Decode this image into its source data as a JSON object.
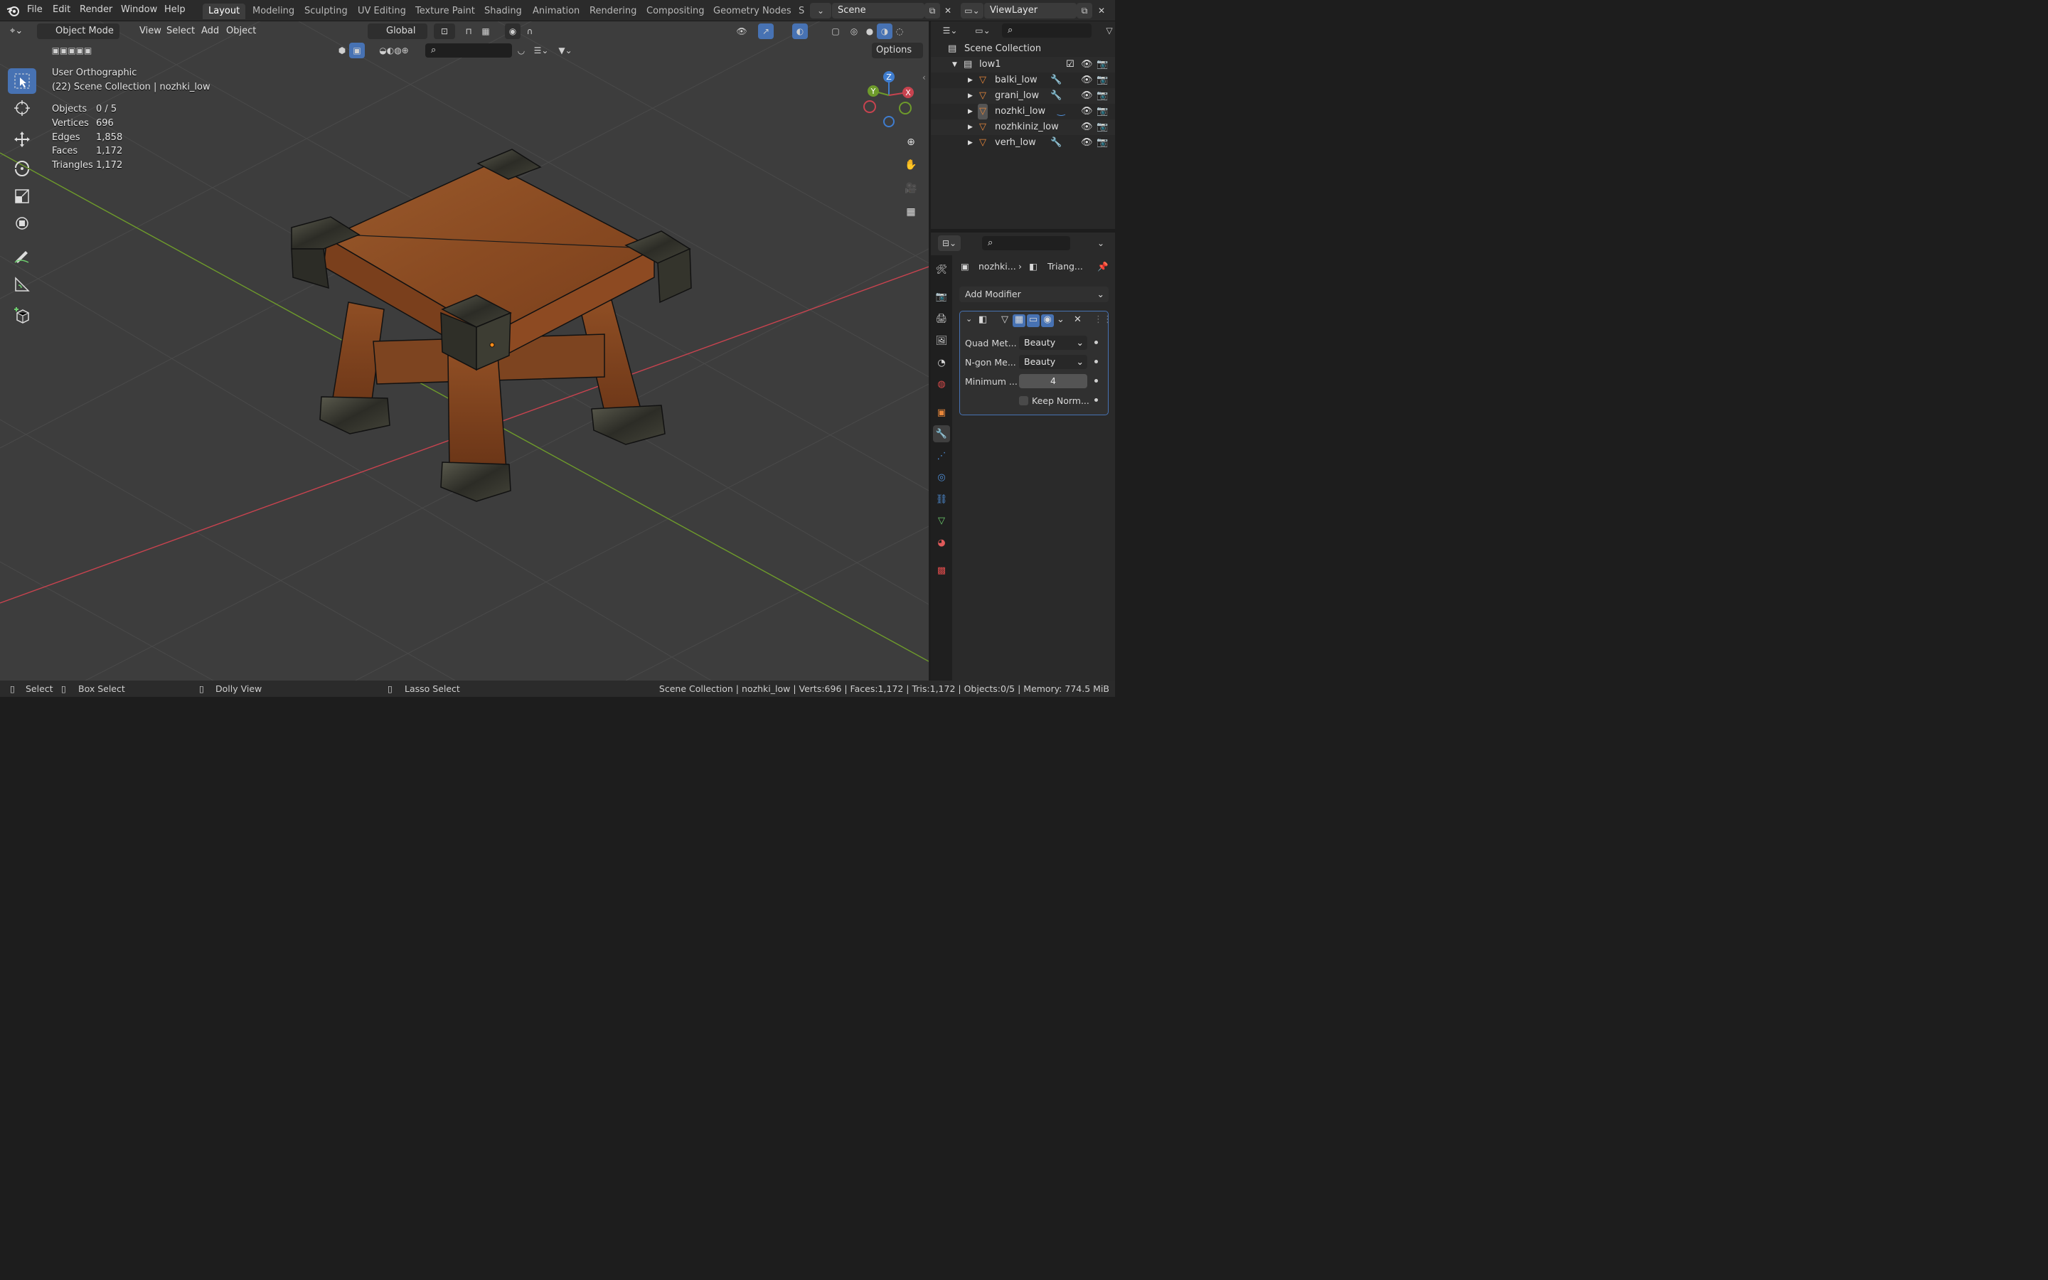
{
  "menu": [
    "File",
    "Edit",
    "Render",
    "Window",
    "Help"
  ],
  "workspaces": [
    {
      "label": "Layout",
      "active": true
    },
    {
      "label": "Modeling"
    },
    {
      "label": "Sculpting"
    },
    {
      "label": "UV Editing"
    },
    {
      "label": "Texture Paint"
    },
    {
      "label": "Shading"
    },
    {
      "label": "Animation"
    },
    {
      "label": "Rendering"
    },
    {
      "label": "Compositing"
    },
    {
      "label": "Geometry Nodes"
    },
    {
      "label": "S"
    }
  ],
  "scene": {
    "value": "Scene"
  },
  "view_layer": {
    "value": "ViewLayer"
  },
  "viewport_header": {
    "mode": "Object Mode",
    "menus": [
      "View",
      "Select",
      "Add",
      "Object"
    ],
    "transform_orientation": "Global",
    "options": "Options"
  },
  "viewport_info": {
    "view_name": "User Orthographic",
    "collection": "(22) Scene Collection | nozhki_low",
    "stats": [
      {
        "label": "Objects",
        "value": "0 / 5"
      },
      {
        "label": "Vertices",
        "value": "696"
      },
      {
        "label": "Edges",
        "value": "1,858"
      },
      {
        "label": "Faces",
        "value": "1,172"
      },
      {
        "label": "Triangles",
        "value": "1,172"
      }
    ]
  },
  "gizmo": {
    "x": "X",
    "y": "Y",
    "z": "Z"
  },
  "outliner": {
    "root": "Scene Collection",
    "collection": "low1",
    "objects": [
      "balki_low",
      "grani_low",
      "nozhki_low",
      "nozhkiniz_low",
      "verh_low"
    ]
  },
  "properties": {
    "breadcrumb_object": "nozhki...",
    "breadcrumb_modifier": "Triang...",
    "add_modifier": "Add Modifier",
    "modifier": {
      "quad_label": "Quad Met...",
      "quad_value": "Beauty",
      "ngon_label": "N-gon Me...",
      "ngon_value": "Beauty",
      "min_label": "Minimum ...",
      "min_value": "4",
      "keep_label": "Keep Norm..."
    }
  },
  "statusbar": {
    "select": "Select",
    "box_select": "Box Select",
    "dolly": "Dolly View",
    "lasso": "Lasso Select",
    "info": "Scene Collection | nozhki_low | Verts:696 | Faces:1,172 | Tris:1,172 | Objects:0/5 | Memory: 774.5 MiB"
  },
  "colors": {
    "accent": "#4772b3",
    "x_axis": "#c8434f",
    "y_axis": "#6e9b2b",
    "z_axis": "#3f7dcf",
    "wood": "#8a4a23"
  }
}
